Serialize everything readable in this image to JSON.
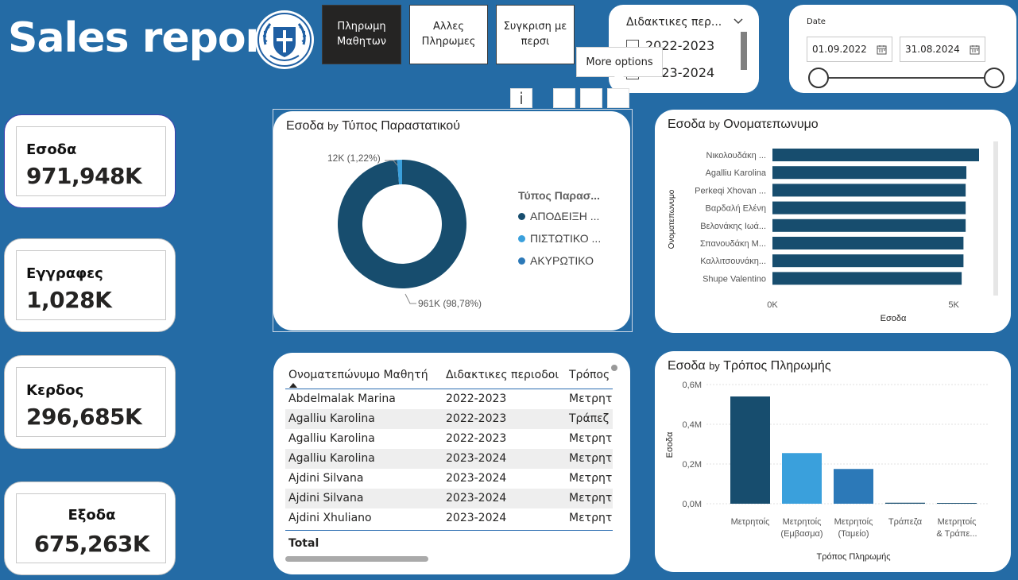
{
  "header": {
    "title": "Sales report",
    "nav": [
      {
        "label": "Πληρωμη\nΜαθητων",
        "active": true
      },
      {
        "label": "Αλλες\nΠληρωμες",
        "active": false
      },
      {
        "label": "Συγκριση με\nπερσι",
        "active": false
      }
    ],
    "tooltip": "More options",
    "info_glyph": "i"
  },
  "period_slicer": {
    "title": "Διδακτικες περ...",
    "options": [
      "2022-2023",
      "2023-2024"
    ]
  },
  "date_slicer": {
    "label": "Date",
    "start": "01.09.2022",
    "end": "31.08.2024"
  },
  "kpis": [
    {
      "label": "Εσοδα",
      "value": "971,948K"
    },
    {
      "label": "Εγγραφες",
      "value": "1,028K"
    },
    {
      "label": "Κερδος",
      "value": "296,685K"
    },
    {
      "label": "Εξοδα",
      "value": "675,263K"
    }
  ],
  "colors": {
    "page_bg": "#246ba5",
    "dark_navy": "#174d6e",
    "light_blue": "#3aa0dc",
    "mid_blue": "#2c79b8",
    "accent_line": "#2a6cb0"
  },
  "donut": {
    "title_main": "Εσοδα",
    "title_by": "by",
    "title_rest": "Τύπος Παραστατικού",
    "legend_title": "Τύπος Παρασ...",
    "legend": [
      "ΑΠΟΔΕΙΞΗ ...",
      "ΠΙΣΤΩΤΙΚΟ ...",
      "ΑΚΥΡΩΤΙΚΟ"
    ],
    "label_small": "12K (1,22%)",
    "label_big": "961K (98,78%)"
  },
  "hbar": {
    "title_main": "Εσοδα",
    "title_by": "by",
    "title_rest": "Ονοματεπωνυμο",
    "xlabel": "Εσοδα",
    "ylabel": "Ονοματεπωνυμο",
    "ticks": [
      "0K",
      "5K"
    ]
  },
  "vbar": {
    "title_main": "Εσοδα",
    "title_by": "by",
    "title_rest": "Τρόπος Πληρωμής",
    "xlabel": "Τρόπος Πληρωμής",
    "ylabel": "Εσοδα",
    "ticks": [
      "0,0M",
      "0,2M",
      "0,4M",
      "0,6M"
    ]
  },
  "chart_data": [
    {
      "type": "pie",
      "title": "Εσοδα by Τύπος Παραστατικού",
      "legend_title": "Τύπος Παρασ...",
      "legend_position": "right",
      "categories": [
        "ΑΠΟΔΕΙΞΗ ...",
        "ΠΙΣΤΩΤΙΚΟ ...",
        "ΑΚΥΡΩΤΙΚΟ"
      ],
      "values": [
        961,
        12,
        0
      ],
      "value_units": "K",
      "data_labels": [
        "961K (98,78%)",
        "12K (1,22%)",
        ""
      ],
      "colors": [
        "#174d6e",
        "#3aa0dc",
        "#2c79b8"
      ]
    },
    {
      "type": "bar",
      "orientation": "horizontal",
      "title": "Εσοδα by Ονοματεπωνυμο",
      "categories": [
        "Νικολουδάκη ...",
        "Agalliu Karolina",
        "Perkeqi Xhovan ...",
        "Βαρδαλή Ελένη",
        "Βελονάκης Ιωά...",
        "Σπανουδάκη Μ...",
        "Καλλιτσουνάκη...",
        "Shupe Valentino"
      ],
      "values": [
        5700,
        5350,
        5330,
        5330,
        5330,
        5270,
        5270,
        5220
      ],
      "xlabel": "Εσοδα",
      "ylabel": "Ονοματεπωνυμο",
      "xlim": [
        0,
        5700
      ],
      "grid": false
    },
    {
      "type": "bar",
      "title": "Εσοδα by Τρόπος Πληρωμής",
      "categories": [
        "Μετρητοίς",
        "Μετρητοίς\n(Εμβασμα)",
        "Μετρητοίς\n(Ταμείο)",
        "Τράπεζα",
        "Μετρητοίς\n& Τράπε..."
      ],
      "values": [
        0.54,
        0.255,
        0.175,
        0.005,
        0.004
      ],
      "value_units": "M",
      "xlabel": "Τρόπος Πληρωμής",
      "ylabel": "Εσοδα",
      "ylim": [
        0,
        0.6
      ],
      "grid": true,
      "colors": [
        "#174d6e",
        "#3aa0dc",
        "#2c79b8",
        "#174d6e",
        "#174d6e"
      ]
    }
  ],
  "table": {
    "headers": [
      "Ονοματεπώνυμο Μαθητή",
      "Διδακτικες περιοδοι",
      "Τρόπος"
    ],
    "rows": [
      [
        "Abdelmalak Marina",
        "2022-2023",
        "Μετρητ"
      ],
      [
        "Agalliu Karolina",
        "2022-2023",
        "Τράπεζ"
      ],
      [
        "Agalliu Karolina",
        "2022-2023",
        "Μετρητ"
      ],
      [
        "Agalliu Karolina",
        "2023-2024",
        "Μετρητ"
      ],
      [
        "Ajdini Silvana",
        "2023-2024",
        "Μετρητ"
      ],
      [
        "Ajdini Silvana",
        "2023-2024",
        "Μετρητ"
      ],
      [
        "Ajdini Xhuliano",
        "2023-2024",
        "Μετρητ"
      ]
    ],
    "total_label": "Total"
  }
}
